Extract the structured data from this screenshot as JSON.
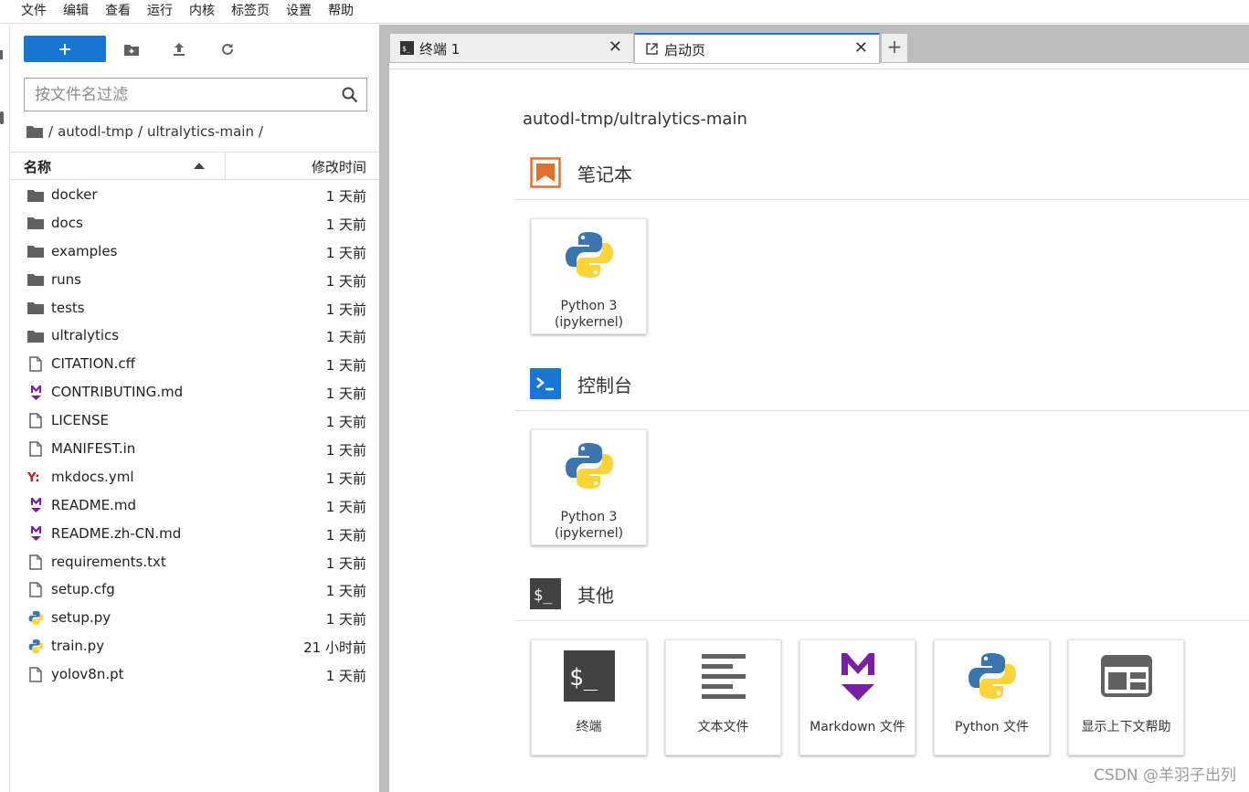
{
  "menu": [
    "文件",
    "编辑",
    "查看",
    "运行",
    "内核",
    "标签页",
    "设置",
    "帮助"
  ],
  "filebrowser": {
    "new_button_label": "+",
    "filter_placeholder": "按文件名过滤",
    "breadcrumbs": [
      "/",
      "autodl-tmp",
      "/",
      "ultralytics-main",
      "/"
    ],
    "columns": {
      "name": "名称",
      "modified": "修改时间"
    },
    "files": [
      {
        "name": "docker",
        "modified": "1 天前",
        "icon": "folder-icon"
      },
      {
        "name": "docs",
        "modified": "1 天前",
        "icon": "folder-icon"
      },
      {
        "name": "examples",
        "modified": "1 天前",
        "icon": "folder-icon"
      },
      {
        "name": "runs",
        "modified": "1 天前",
        "icon": "folder-icon"
      },
      {
        "name": "tests",
        "modified": "1 天前",
        "icon": "folder-icon"
      },
      {
        "name": "ultralytics",
        "modified": "1 天前",
        "icon": "folder-icon"
      },
      {
        "name": "CITATION.cff",
        "modified": "1 天前",
        "icon": "file-icon"
      },
      {
        "name": "CONTRIBUTING.md",
        "modified": "1 天前",
        "icon": "markdown-icon"
      },
      {
        "name": "LICENSE",
        "modified": "1 天前",
        "icon": "file-icon"
      },
      {
        "name": "MANIFEST.in",
        "modified": "1 天前",
        "icon": "file-icon"
      },
      {
        "name": "mkdocs.yml",
        "modified": "1 天前",
        "icon": "yaml-icon"
      },
      {
        "name": "README.md",
        "modified": "1 天前",
        "icon": "markdown-icon"
      },
      {
        "name": "README.zh-CN.md",
        "modified": "1 天前",
        "icon": "markdown-icon"
      },
      {
        "name": "requirements.txt",
        "modified": "1 天前",
        "icon": "file-icon"
      },
      {
        "name": "setup.cfg",
        "modified": "1 天前",
        "icon": "file-icon"
      },
      {
        "name": "setup.py",
        "modified": "1 天前",
        "icon": "python-icon"
      },
      {
        "name": "train.py",
        "modified": "21 小时前",
        "icon": "python-icon"
      },
      {
        "name": "yolov8n.pt",
        "modified": "1 天前",
        "icon": "file-icon"
      }
    ]
  },
  "tabs": [
    {
      "label": "终端 1",
      "icon": "terminal-icon",
      "active": false
    },
    {
      "label": "启动页",
      "icon": "launcher-icon",
      "active": true
    }
  ],
  "tab_add": "+",
  "tab_close": "✕",
  "launcher": {
    "cwd": "autodl-tmp/ultralytics-main",
    "sections": {
      "notebook": {
        "title": "笔记本",
        "cards": [
          {
            "label_line1": "Python 3",
            "label_line2": "(ipykernel)"
          }
        ]
      },
      "console": {
        "title": "控制台",
        "cards": [
          {
            "label_line1": "Python 3",
            "label_line2": "(ipykernel)"
          }
        ]
      },
      "other": {
        "title": "其他",
        "cards": [
          {
            "label": "终端",
            "icon": "terminal-icon"
          },
          {
            "label": "文本文件",
            "icon": "text-file-icon"
          },
          {
            "label": "Markdown 文件",
            "icon": "markdown-icon"
          },
          {
            "label": "Python 文件",
            "icon": "python-icon"
          },
          {
            "label": "显示上下文帮助",
            "icon": "context-help-icon"
          }
        ]
      }
    }
  },
  "watermark": "CSDN @羊羽子出列",
  "colors": {
    "accent": "#1976d2",
    "notebook_orange": "#e46e2e",
    "markdown_purple": "#7b1fa2",
    "terminal_dark": "#424242"
  }
}
